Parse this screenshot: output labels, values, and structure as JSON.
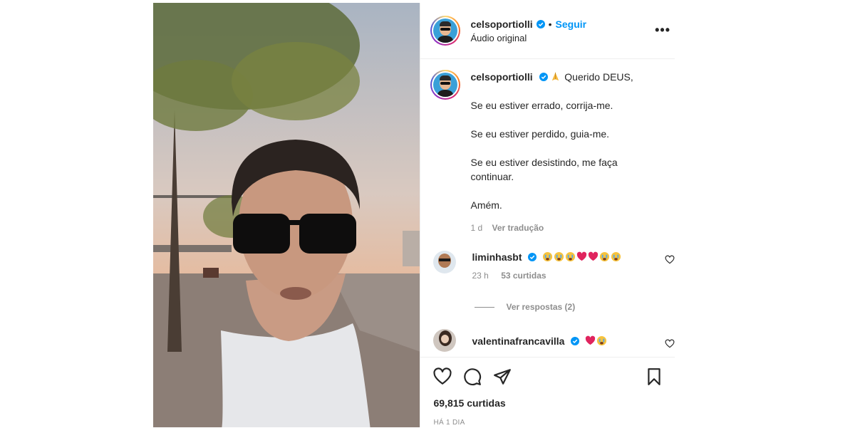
{
  "post": {
    "username": "celsoportiolli",
    "follow_label": "Seguir",
    "separator": "•",
    "audio_label": "Áudio original",
    "more_label": "•••"
  },
  "caption": {
    "username": "celsoportiolli",
    "first_line": "Querido DEUS,",
    "lines": [
      "Se eu estiver errado, corrija-me.",
      "Se eu estiver perdido, guia-me.",
      "Se eu estiver desistindo, me faça continuar.",
      "Amém."
    ],
    "time": "1 d",
    "translate_label": "Ver tradução"
  },
  "comments": [
    {
      "username": "liminhasbt",
      "emojis": [
        "crying-face",
        "crying-face",
        "crying-face",
        "red-heart",
        "red-heart",
        "crying-face",
        "crying-face"
      ],
      "time": "23 h",
      "likes": "53 curtidas",
      "replies_label": "Ver respostas (2)"
    },
    {
      "username": "valentinafrancavilla",
      "emojis": [
        "red-heart",
        "crying-face"
      ]
    }
  ],
  "footer": {
    "likes": "69,815 curtidas",
    "ago": "HÁ 1 DIA"
  },
  "colors": {
    "accent": "#0095f6",
    "verified": "#0095f6",
    "muted": "#8e8e8e",
    "heart": "#e0245e"
  },
  "icons": [
    "heart-icon",
    "comment-icon",
    "share-icon",
    "bookmark-icon",
    "verified-icon",
    "more-icon"
  ]
}
